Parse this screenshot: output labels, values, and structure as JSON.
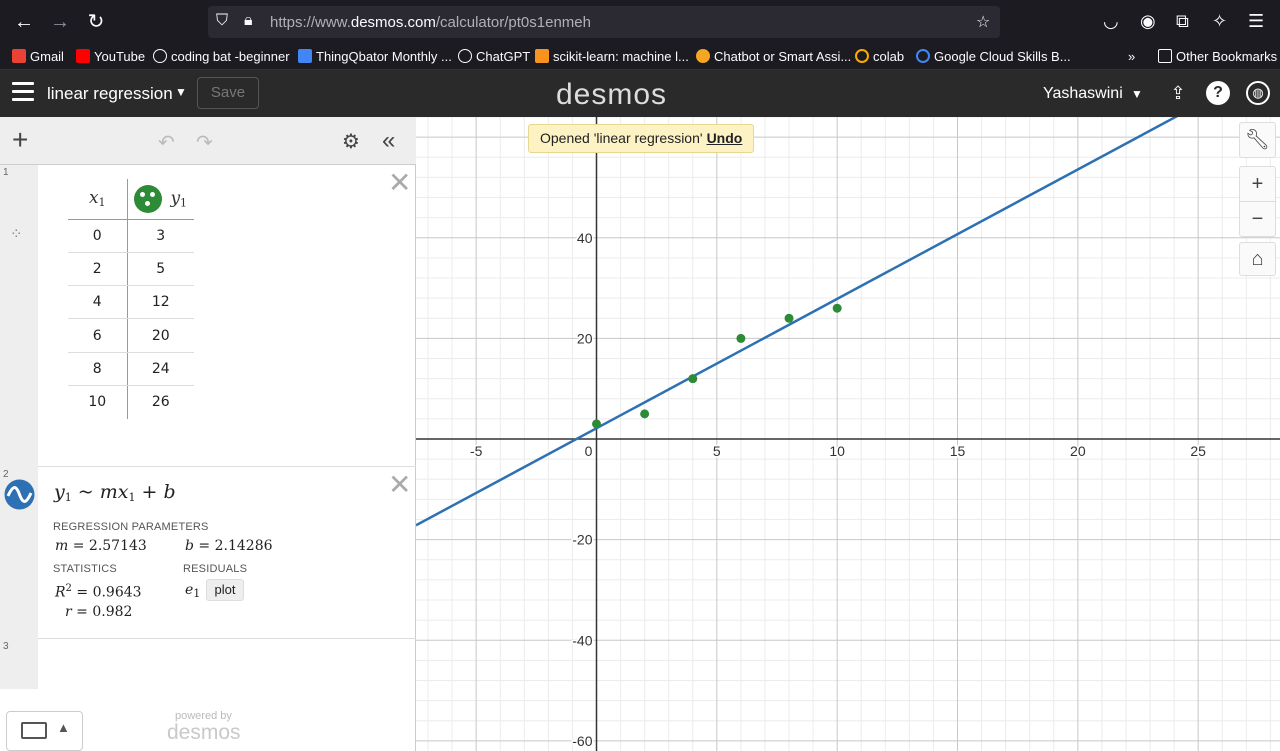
{
  "browser": {
    "url_prefix": "https://www.",
    "url_domain": "desmos.com",
    "url_path": "/calculator/pt0s1enmeh"
  },
  "bookmarks": [
    {
      "label": "Gmail",
      "color": "#ea4335"
    },
    {
      "label": "YouTube",
      "color": "#ff0000"
    },
    {
      "label": "coding bat -beginner",
      "color": "#fbfbfe"
    },
    {
      "label": "ThingQbator Monthly ...",
      "color": "#4285f4"
    },
    {
      "label": "ChatGPT",
      "color": "#fbfbfe"
    },
    {
      "label": "scikit-learn: machine l...",
      "color": "#f7931e"
    },
    {
      "label": "Chatbot or Smart Assi...",
      "color": "#f5a623"
    },
    {
      "label": "colab",
      "color": "#f9ab00"
    },
    {
      "label": "Google Cloud Skills B...",
      "color": "#4285f4"
    }
  ],
  "other_bookmarks": "Other Bookmarks",
  "header": {
    "graph_title": "linear regression",
    "save_label": "Save",
    "logo": "desmos",
    "user_name": "Yashaswini"
  },
  "expressions": {
    "table": {
      "number": "1",
      "col_x": "x",
      "col_x_sub": "1",
      "col_y": "y",
      "col_y_sub": "1",
      "point_color": "#2d8a37",
      "rows": [
        {
          "x": "0",
          "y": "3"
        },
        {
          "x": "2",
          "y": "5"
        },
        {
          "x": "4",
          "y": "12"
        },
        {
          "x": "6",
          "y": "20"
        },
        {
          "x": "8",
          "y": "24"
        },
        {
          "x": "10",
          "y": "26"
        }
      ]
    },
    "regression": {
      "number": "2",
      "line_color": "#2d70b3",
      "params_label": "REGRESSION PARAMETERS",
      "m_value": "2.57143",
      "b_value": "2.14286",
      "stats_label": "STATISTICS",
      "residuals_label": "RESIDUALS",
      "r2_value": "0.9643",
      "r_value": "0.982",
      "residual_var": "e",
      "residual_sub": "1",
      "plot_label": "plot"
    },
    "empty": {
      "number": "3"
    }
  },
  "powered_by": "powered by",
  "powered_logo": "desmos",
  "toast": {
    "message": "Opened 'linear regression'",
    "undo_label": "Undo"
  },
  "chart_data": {
    "type": "scatter",
    "x_ticks": [
      "-5",
      "0",
      "5",
      "10",
      "15",
      "20",
      "25"
    ],
    "y_ticks": [
      "40",
      "20",
      "-20",
      "-40",
      "-60"
    ],
    "xlim": [
      -7.5,
      28.4
    ],
    "ylim": [
      -62,
      64
    ],
    "grid": true,
    "points": [
      [
        0,
        3
      ],
      [
        2,
        5
      ],
      [
        4,
        12
      ],
      [
        6,
        20
      ],
      [
        8,
        24
      ],
      [
        10,
        26
      ]
    ],
    "regression_line": {
      "m": 2.57143,
      "b": 2.14286
    }
  }
}
